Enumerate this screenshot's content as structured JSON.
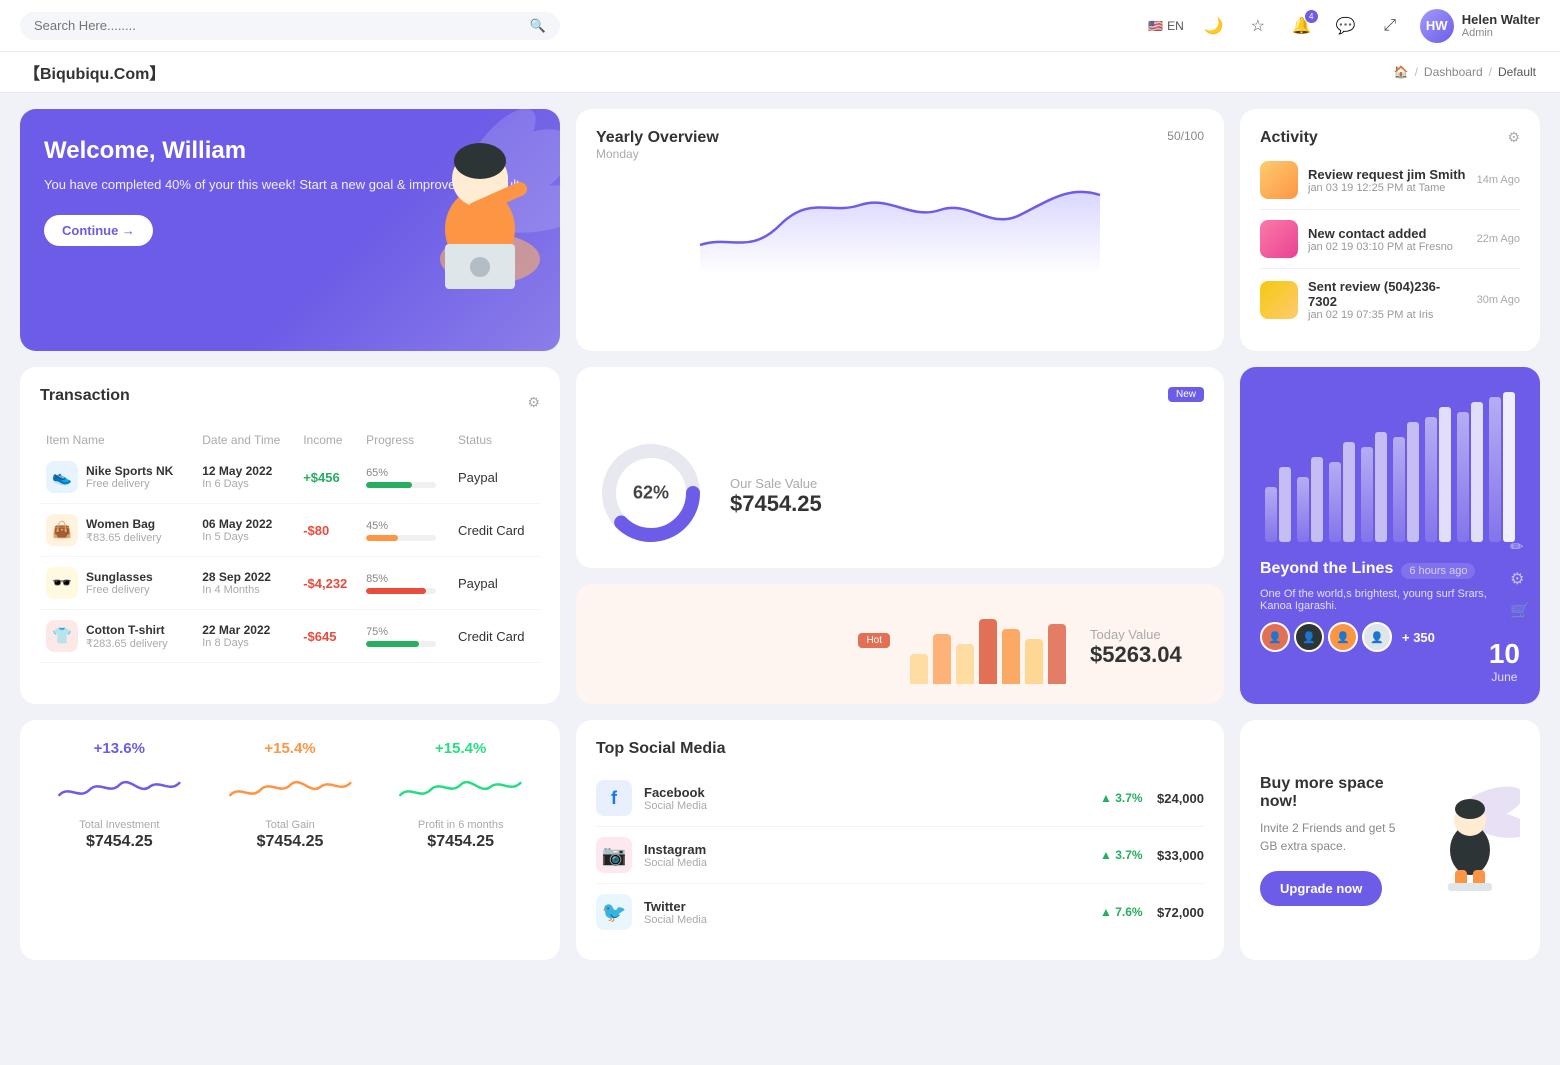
{
  "topnav": {
    "search_placeholder": "Search Here........",
    "language": "EN",
    "notification_count": "4",
    "user_name": "Helen Walter",
    "user_role": "Admin"
  },
  "breadcrumb": {
    "site_title": "【Biqubiqu.Com】",
    "home_label": "🏠",
    "dashboard_label": "Dashboard",
    "current_label": "Default"
  },
  "welcome": {
    "greeting": "Welcome, William",
    "message": "You have completed 40% of your this week! Start a new goal & improve your result",
    "button_label": "Continue →"
  },
  "yearly_overview": {
    "title": "Yearly Overview",
    "subtitle": "Monday",
    "progress": "50/100"
  },
  "activity": {
    "title": "Activity",
    "items": [
      {
        "title": "Review request jim Smith",
        "desc": "jan 03 19 12:25 PM at Tame",
        "time": "14m Ago",
        "color": "#fdcb6e"
      },
      {
        "title": "New contact added",
        "desc": "jan 02 19 03:10 PM at Fresno",
        "time": "22m Ago",
        "color": "#fd79a8"
      },
      {
        "title": "Sent review (504)236-7302",
        "desc": "jan 02 19 07:35 PM at Iris",
        "time": "30m Ago",
        "color": "#f6c90e"
      }
    ]
  },
  "transaction": {
    "title": "Transaction",
    "headers": [
      "Item Name",
      "Date and Time",
      "Income",
      "Progress",
      "Status"
    ],
    "rows": [
      {
        "name": "Nike Sports NK",
        "sub": "Free delivery",
        "icon": "👟",
        "icon_color": "#e8f4fd",
        "date": "12 May 2022",
        "date_sub": "In 6 Days",
        "income": "+$456",
        "income_type": "pos",
        "progress": 65,
        "progress_color": "#27ae60",
        "status": "Paypal"
      },
      {
        "name": "Women Bag",
        "sub": "₹83.65 delivery",
        "icon": "👜",
        "icon_color": "#fff3e0",
        "date": "06 May 2022",
        "date_sub": "In 5 Days",
        "income": "-$80",
        "income_type": "neg",
        "progress": 45,
        "progress_color": "#fd9644",
        "status": "Credit Card"
      },
      {
        "name": "Sunglasses",
        "sub": "Free delivery",
        "icon": "🕶️",
        "icon_color": "#fff9e0",
        "date": "28 Sep 2022",
        "date_sub": "In 4 Months",
        "income": "-$4,232",
        "income_type": "neg",
        "progress": 85,
        "progress_color": "#e74c3c",
        "status": "Paypal"
      },
      {
        "name": "Cotton T-shirt",
        "sub": "₹283.65 delivery",
        "icon": "👕",
        "icon_color": "#fde8e8",
        "date": "22 Mar 2022",
        "date_sub": "In 8 Days",
        "income": "-$645",
        "income_type": "neg",
        "progress": 75,
        "progress_color": "#27ae60",
        "status": "Credit Card"
      }
    ]
  },
  "sale_value": {
    "badge": "New",
    "donut_pct": "62%",
    "label": "Our Sale Value",
    "value": "$7454.25"
  },
  "today_value": {
    "badge": "Hot",
    "label": "Today Value",
    "value": "$5263.04",
    "bars": [
      30,
      50,
      40,
      65,
      55,
      45,
      60
    ]
  },
  "beyond": {
    "title": "Beyond the Lines",
    "time_ago": "6 hours ago",
    "description": "One Of the world,s brightest, young surf Srars, Kanoa Igarashi.",
    "plus_count": "+ 350",
    "date_num": "10",
    "date_month": "June"
  },
  "stats": [
    {
      "pct": "+13.6%",
      "color": "blue",
      "label": "Total Investment",
      "value": "$7454.25"
    },
    {
      "pct": "+15.4%",
      "color": "orange",
      "label": "Total Gain",
      "value": "$7454.25"
    },
    {
      "pct": "+15.4%",
      "color": "green",
      "label": "Profit in 6 months",
      "value": "$7454.25"
    }
  ],
  "social": {
    "title": "Top Social Media",
    "items": [
      {
        "name": "Facebook",
        "sub": "Social Media",
        "icon": "f",
        "icon_bg": "#1877f2",
        "growth": "3.7%",
        "revenue": "$24,000"
      },
      {
        "name": "Instagram",
        "sub": "Social Media",
        "icon": "📷",
        "icon_bg": "#e1306c",
        "growth": "3.7%",
        "revenue": "$33,000"
      },
      {
        "name": "Twitter",
        "sub": "Social Media",
        "icon": "🐦",
        "icon_bg": "#1da1f2",
        "growth": "7.6%",
        "revenue": "$72,000"
      }
    ]
  },
  "buyspace": {
    "title": "Buy more space now!",
    "subtitle": "Invite 2 Friends and get 5 GB extra space.",
    "button_label": "Upgrade now"
  }
}
